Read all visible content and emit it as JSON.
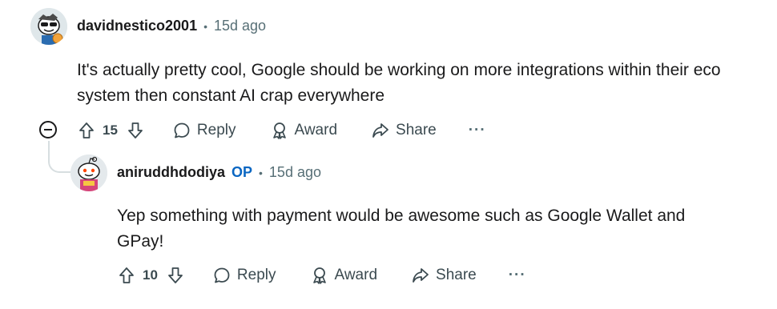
{
  "comments": [
    {
      "username": "davidnestico2001",
      "separator": "•",
      "time": "15d ago",
      "body": "It's actually pretty cool, Google should be working on more integrations within their eco system then constant AI crap everywhere",
      "votes": "15",
      "actions": {
        "reply": "Reply",
        "award": "Award",
        "share": "Share",
        "more": "···"
      }
    },
    {
      "username": "aniruddhdodiya",
      "op_badge": "OP",
      "separator": "•",
      "time": "15d ago",
      "body": "Yep something with payment would be awesome such as Google Wallet and GPay!",
      "votes": "10",
      "actions": {
        "reply": "Reply",
        "award": "Award",
        "share": "Share",
        "more": "···"
      }
    }
  ],
  "colors": {
    "meta": "#576f76",
    "op": "#0a66c2",
    "text": "#1a1a1b"
  }
}
